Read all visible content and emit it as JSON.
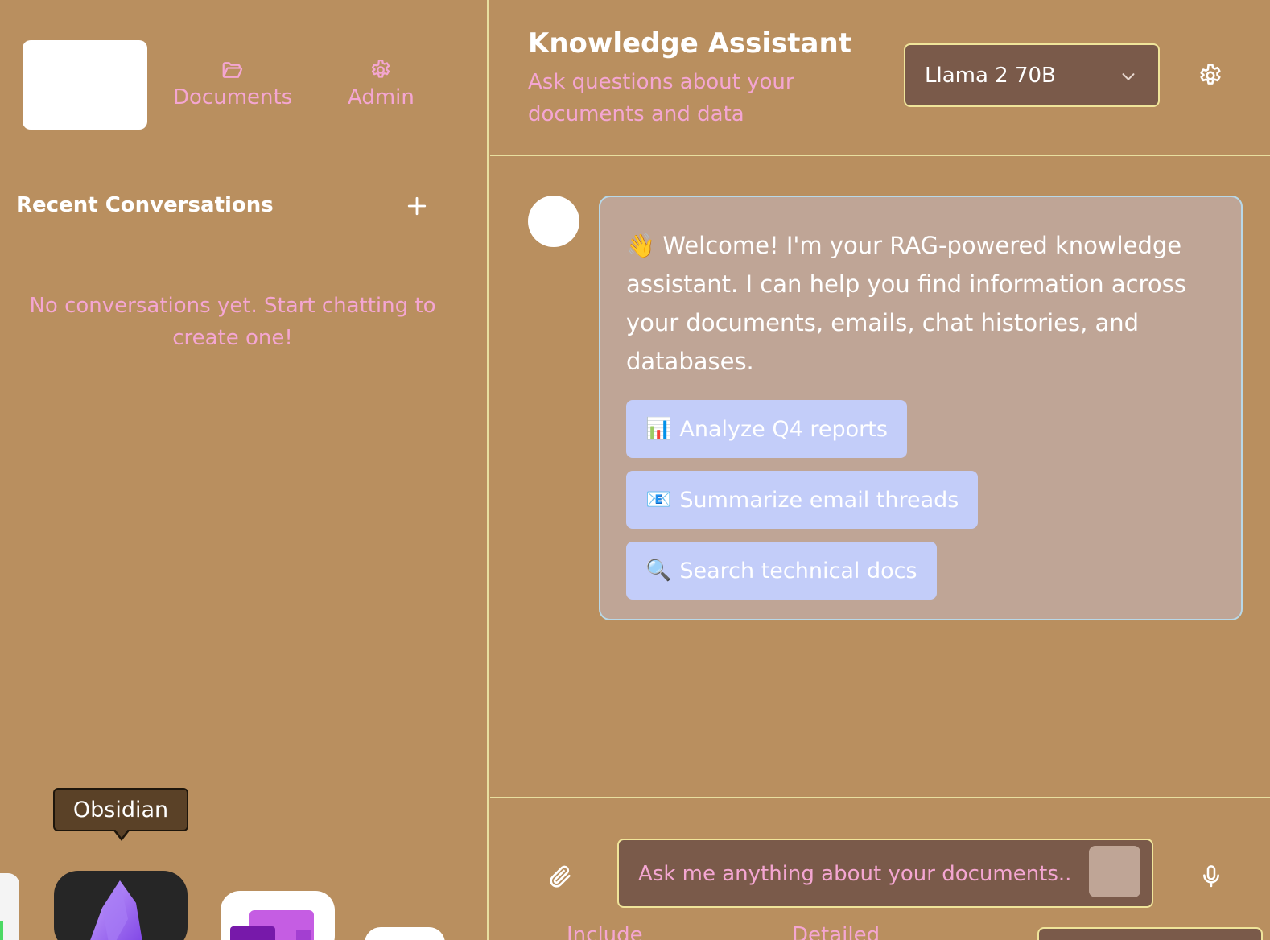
{
  "sidebar": {
    "nav": {
      "documents": "Documents",
      "admin": "Admin"
    },
    "recent_title": "Recent Conversations",
    "empty_message": "No conversations yet. Start chatting to create one!"
  },
  "dock": {
    "tooltip": "Obsidian"
  },
  "header": {
    "title": "Knowledge Assistant",
    "subtitle": "Ask questions about your documents and data",
    "model": "Llama 2 70B"
  },
  "chat": {
    "welcome_emoji": "👋",
    "welcome_text": "Welcome! I'm your RAG-powered knowledge assistant. I can help you find information across your documents, emails, chat histories, and databases.",
    "suggestions": [
      {
        "emoji": "📊",
        "label": "Analyze Q4 reports"
      },
      {
        "emoji": "📧",
        "label": "Summarize email threads"
      },
      {
        "emoji": "🔍",
        "label": "Search technical docs"
      }
    ]
  },
  "composer": {
    "placeholder": "Ask me anything about your documents...",
    "option_1": "Include",
    "option_2": "Detailed"
  },
  "colors": {
    "background": "#b98f5f",
    "accent_pink": "#f4a6d2",
    "divider": "#e8dfa0",
    "bubble": "#bfa596",
    "suggestion": "#c3cdf9",
    "input": "#7a5a4a"
  },
  "icons": {
    "documents": "folder-open-icon",
    "admin": "gear-icon",
    "new": "plus-icon",
    "select": "chevron-down-icon",
    "settings": "gear-icon",
    "attach": "paperclip-icon",
    "mic": "microphone-icon"
  }
}
